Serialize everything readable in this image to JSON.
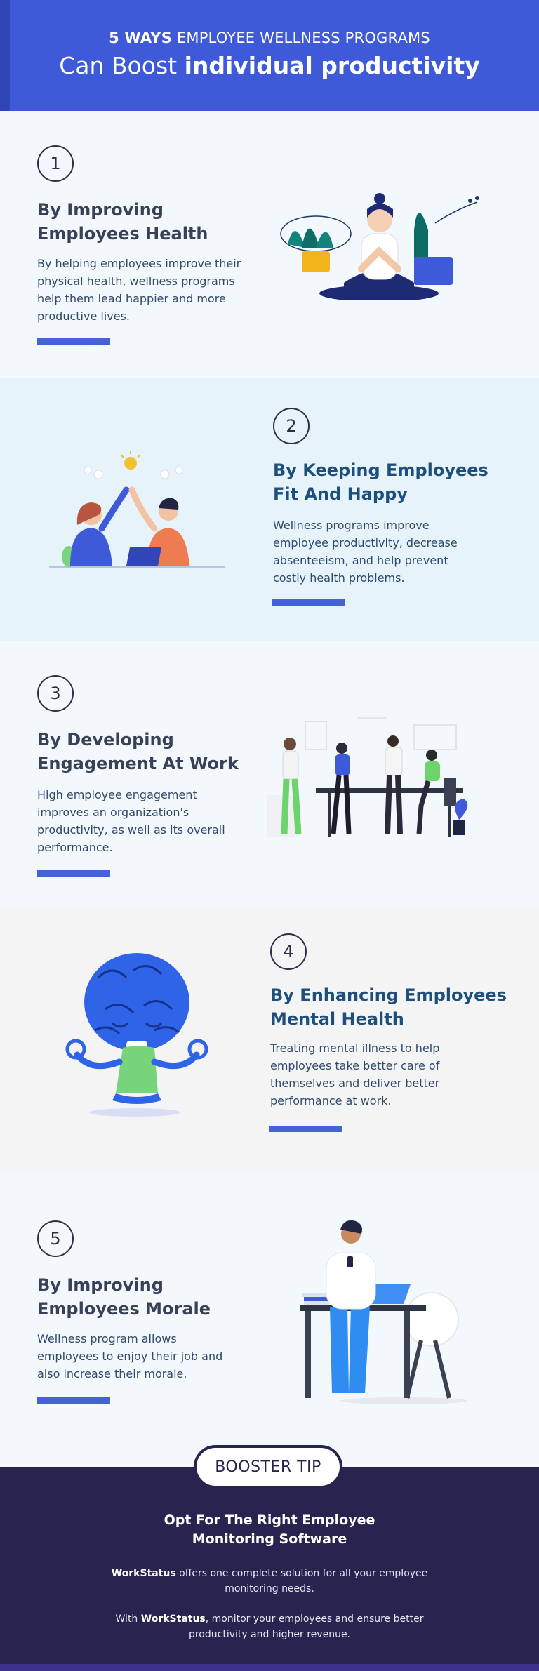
{
  "header": {
    "line1_bold": "5 WAYS",
    "line1_rest": " EMPLOYEE WELLNESS PROGRAMS",
    "line2_regular": "Can Boost ",
    "line2_bold": "individual productivity"
  },
  "sections": [
    {
      "number": "1",
      "title_line1": "By Improving",
      "title_line2": "Employees Health",
      "desc": [
        "By helping employees improve their",
        "physical health, wellness programs",
        "help them lead happier and more",
        "productive lives."
      ]
    },
    {
      "number": "2",
      "title_line1": "By Keeping Employees",
      "title_line2": "Fit And Happy",
      "desc": [
        "Wellness programs improve",
        "employee productivity, decrease",
        "absenteeism, and help prevent",
        "costly health problems."
      ]
    },
    {
      "number": "3",
      "title_line1": "By Developing",
      "title_line2": "Engagement At Work",
      "desc": [
        "High employee engagement",
        "improves an organization's",
        "productivity, as well as its overall",
        "performance."
      ]
    },
    {
      "number": "4",
      "title_line1": "By Enhancing Employees",
      "title_line2": "Mental Health",
      "desc": [
        "Treating mental illness to help",
        "employees take better care of",
        "themselves and deliver better",
        "performance at work."
      ]
    },
    {
      "number": "5",
      "title_line1": "By Improving",
      "title_line2": "Employees Morale",
      "desc": [
        "Wellness program allows",
        "employees to enjoy their job and",
        "also increase their morale."
      ]
    }
  ],
  "booster": {
    "pill": "BOOSTER TIP",
    "title_line1": "Opt For The Right Employee",
    "title_line2": "Monitoring Software",
    "p1_brand": "WorkStatus",
    "p1_rest": " offers one complete solution for all your employee",
    "p1_line2": "monitoring needs.",
    "p2_pre": "With ",
    "p2_brand": "WorkStatus",
    "p2_rest": ", monitor your employees and ensure better",
    "p2_line2": "productivity and higher revenue."
  },
  "colors": {
    "header_bg": "#3f5ad8",
    "accent_bar": "#4562d6",
    "booster_bg": "#29234f",
    "blue_title": "#1c4f7e"
  }
}
